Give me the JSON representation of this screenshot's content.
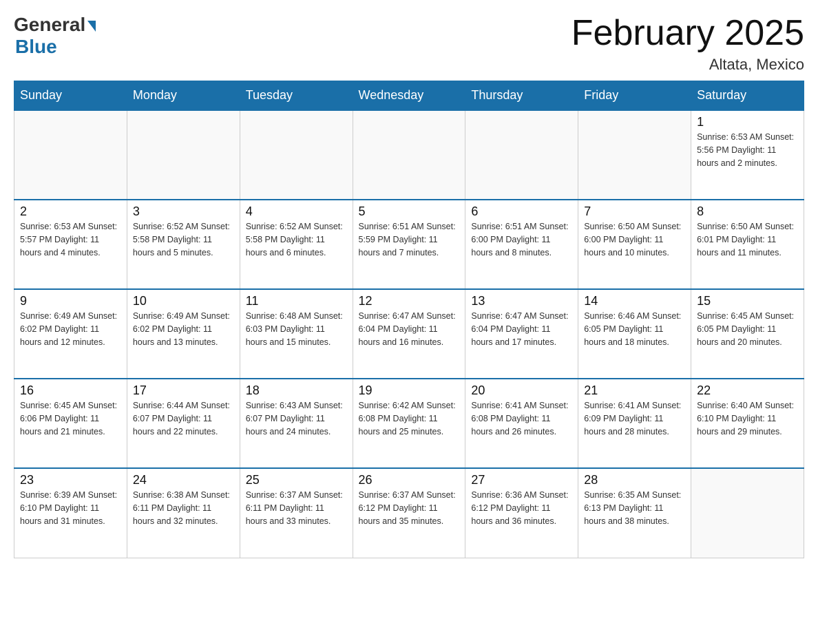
{
  "logo": {
    "general": "General",
    "blue": "Blue"
  },
  "title": "February 2025",
  "location": "Altata, Mexico",
  "days_of_week": [
    "Sunday",
    "Monday",
    "Tuesday",
    "Wednesday",
    "Thursday",
    "Friday",
    "Saturday"
  ],
  "weeks": [
    [
      {
        "day": "",
        "info": ""
      },
      {
        "day": "",
        "info": ""
      },
      {
        "day": "",
        "info": ""
      },
      {
        "day": "",
        "info": ""
      },
      {
        "day": "",
        "info": ""
      },
      {
        "day": "",
        "info": ""
      },
      {
        "day": "1",
        "info": "Sunrise: 6:53 AM\nSunset: 5:56 PM\nDaylight: 11 hours\nand 2 minutes."
      }
    ],
    [
      {
        "day": "2",
        "info": "Sunrise: 6:53 AM\nSunset: 5:57 PM\nDaylight: 11 hours\nand 4 minutes."
      },
      {
        "day": "3",
        "info": "Sunrise: 6:52 AM\nSunset: 5:58 PM\nDaylight: 11 hours\nand 5 minutes."
      },
      {
        "day": "4",
        "info": "Sunrise: 6:52 AM\nSunset: 5:58 PM\nDaylight: 11 hours\nand 6 minutes."
      },
      {
        "day": "5",
        "info": "Sunrise: 6:51 AM\nSunset: 5:59 PM\nDaylight: 11 hours\nand 7 minutes."
      },
      {
        "day": "6",
        "info": "Sunrise: 6:51 AM\nSunset: 6:00 PM\nDaylight: 11 hours\nand 8 minutes."
      },
      {
        "day": "7",
        "info": "Sunrise: 6:50 AM\nSunset: 6:00 PM\nDaylight: 11 hours\nand 10 minutes."
      },
      {
        "day": "8",
        "info": "Sunrise: 6:50 AM\nSunset: 6:01 PM\nDaylight: 11 hours\nand 11 minutes."
      }
    ],
    [
      {
        "day": "9",
        "info": "Sunrise: 6:49 AM\nSunset: 6:02 PM\nDaylight: 11 hours\nand 12 minutes."
      },
      {
        "day": "10",
        "info": "Sunrise: 6:49 AM\nSunset: 6:02 PM\nDaylight: 11 hours\nand 13 minutes."
      },
      {
        "day": "11",
        "info": "Sunrise: 6:48 AM\nSunset: 6:03 PM\nDaylight: 11 hours\nand 15 minutes."
      },
      {
        "day": "12",
        "info": "Sunrise: 6:47 AM\nSunset: 6:04 PM\nDaylight: 11 hours\nand 16 minutes."
      },
      {
        "day": "13",
        "info": "Sunrise: 6:47 AM\nSunset: 6:04 PM\nDaylight: 11 hours\nand 17 minutes."
      },
      {
        "day": "14",
        "info": "Sunrise: 6:46 AM\nSunset: 6:05 PM\nDaylight: 11 hours\nand 18 minutes."
      },
      {
        "day": "15",
        "info": "Sunrise: 6:45 AM\nSunset: 6:05 PM\nDaylight: 11 hours\nand 20 minutes."
      }
    ],
    [
      {
        "day": "16",
        "info": "Sunrise: 6:45 AM\nSunset: 6:06 PM\nDaylight: 11 hours\nand 21 minutes."
      },
      {
        "day": "17",
        "info": "Sunrise: 6:44 AM\nSunset: 6:07 PM\nDaylight: 11 hours\nand 22 minutes."
      },
      {
        "day": "18",
        "info": "Sunrise: 6:43 AM\nSunset: 6:07 PM\nDaylight: 11 hours\nand 24 minutes."
      },
      {
        "day": "19",
        "info": "Sunrise: 6:42 AM\nSunset: 6:08 PM\nDaylight: 11 hours\nand 25 minutes."
      },
      {
        "day": "20",
        "info": "Sunrise: 6:41 AM\nSunset: 6:08 PM\nDaylight: 11 hours\nand 26 minutes."
      },
      {
        "day": "21",
        "info": "Sunrise: 6:41 AM\nSunset: 6:09 PM\nDaylight: 11 hours\nand 28 minutes."
      },
      {
        "day": "22",
        "info": "Sunrise: 6:40 AM\nSunset: 6:10 PM\nDaylight: 11 hours\nand 29 minutes."
      }
    ],
    [
      {
        "day": "23",
        "info": "Sunrise: 6:39 AM\nSunset: 6:10 PM\nDaylight: 11 hours\nand 31 minutes."
      },
      {
        "day": "24",
        "info": "Sunrise: 6:38 AM\nSunset: 6:11 PM\nDaylight: 11 hours\nand 32 minutes."
      },
      {
        "day": "25",
        "info": "Sunrise: 6:37 AM\nSunset: 6:11 PM\nDaylight: 11 hours\nand 33 minutes."
      },
      {
        "day": "26",
        "info": "Sunrise: 6:37 AM\nSunset: 6:12 PM\nDaylight: 11 hours\nand 35 minutes."
      },
      {
        "day": "27",
        "info": "Sunrise: 6:36 AM\nSunset: 6:12 PM\nDaylight: 11 hours\nand 36 minutes."
      },
      {
        "day": "28",
        "info": "Sunrise: 6:35 AM\nSunset: 6:13 PM\nDaylight: 11 hours\nand 38 minutes."
      },
      {
        "day": "",
        "info": ""
      }
    ]
  ]
}
